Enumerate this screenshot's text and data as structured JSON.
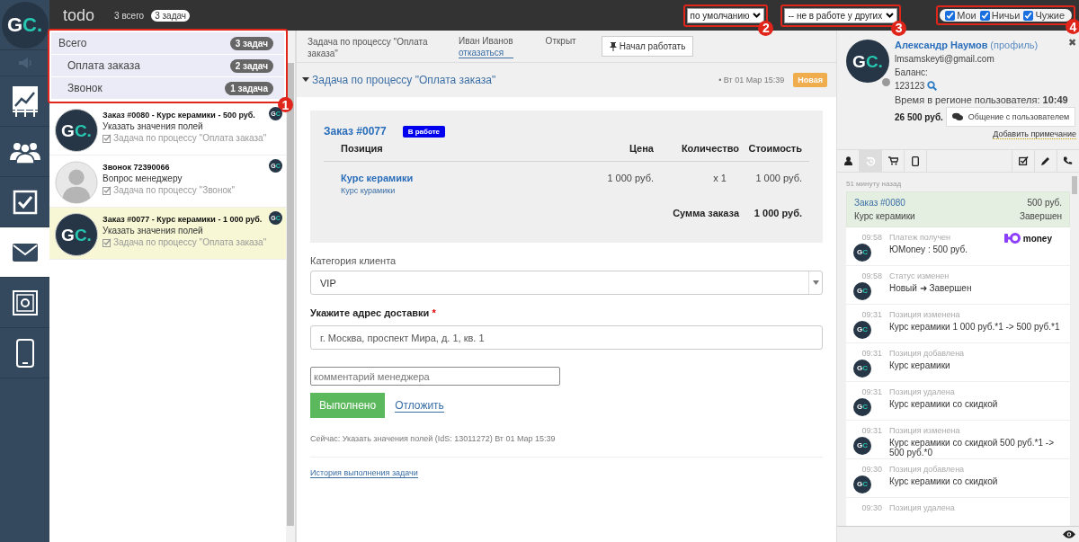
{
  "nav": {
    "logo": "GC.",
    "items": [
      {
        "kind": "speaker",
        "selected": false
      },
      {
        "kind": "chart",
        "selected": false
      },
      {
        "kind": "people",
        "selected": false
      },
      {
        "kind": "checkbox",
        "selected": false
      },
      {
        "kind": "mail",
        "selected": true
      },
      {
        "kind": "safe",
        "selected": false
      },
      {
        "kind": "phone",
        "selected": false
      }
    ]
  },
  "topbar": {
    "title": "todo",
    "total": "3 всего",
    "badge": "3 задач",
    "sort_select": {
      "value": "по умолчанию",
      "callout": "2"
    },
    "filter_select": {
      "value": "-- не в работе у других",
      "callout": "3"
    },
    "owner_filters": {
      "callout": "4",
      "options": [
        {
          "label": "Мои",
          "checked": true
        },
        {
          "label": "Ничьи",
          "checked": true
        },
        {
          "label": "Чужие",
          "checked": true
        }
      ]
    }
  },
  "task_groups": {
    "callout": "1",
    "items": [
      {
        "label": "Всего",
        "count": "3 задач",
        "children": [
          {
            "label": "Оплата заказа",
            "count": "2 задач"
          },
          {
            "label": "Звонок",
            "count": "1 задача"
          }
        ]
      }
    ]
  },
  "tasks": [
    {
      "title": "Заказ #0080 - Курс керамики - 500 руб.",
      "subtitle": "Указать значения полей",
      "process": "Задача по процессу \"Оплата заказа\"",
      "avatar": {
        "kind": "logo",
        "text": "GC."
      },
      "badge": "GC",
      "selected": false
    },
    {
      "title": "Звонок 72390066",
      "subtitle": "Вопрос менеджеру",
      "process": "Задача по процессу \"Звонок\"",
      "avatar": {
        "kind": "person"
      },
      "badge": "GC",
      "selected": false
    },
    {
      "title": "Заказ #0077 - Курс керамики - 1 000 руб.",
      "subtitle": "Указать значения полей",
      "process": "Задача по процессу \"Оплата заказа\"",
      "avatar": {
        "kind": "logo",
        "text": "GC."
      },
      "badge": "GC",
      "selected": true
    }
  ],
  "task_header": {
    "process": "Задача по процессу \"Оплата заказа\"",
    "assignee": "Иван Иванов",
    "decline_link": "отказаться",
    "status": "Открыт",
    "start_button": "Начал работать"
  },
  "task_title": {
    "link": "Задача по процессу \"Оплата заказа\"",
    "expanded": true,
    "date": "• Вт 01 Мар 15:39",
    "badge": "Новая"
  },
  "order": {
    "title": "Заказ #0077",
    "status": "В работе",
    "columns": [
      "Позиция",
      "Цена",
      "Количество",
      "Стоимость"
    ],
    "rows": [
      {
        "name": "Курс керамики",
        "note": "Курс курамики",
        "price": "1 000 руб.",
        "quantity": "x 1",
        "cost": "1 000 руб."
      }
    ],
    "total_label": "Сумма заказа",
    "total": "1 000 руб."
  },
  "form": {
    "category_label": "Категория клиента",
    "category_value": "VIP",
    "address_label": "Укажите адрес доставки",
    "required_mark": "*",
    "address_value": "г. Москва, проспект Мира, д. 1, кв. 1",
    "comment_placeholder": "комментарий менеджера",
    "done_button": "Выполнено",
    "postpone_link": "Отложить",
    "status_line": "Сейчас: Указать значения полей (IdS: 13011272) Вт 01 Мар 15:39",
    "history_link": "История выполнения задачи"
  },
  "profile": {
    "avatar": "GC.",
    "online": false,
    "name": "Александр Наумов",
    "profile_link": "(профиль)",
    "email": "lmsamskeyti@gmail.com",
    "balance_label": "Баланс:",
    "balance": "123123",
    "region_time": "Время в регионе пользователя: **10:49**",
    "amount": "26 500 руб.",
    "chat_button": "Общение с пользователем",
    "note_link": "Добавить примечание",
    "close": "✖"
  },
  "panel_tabs": [
    {
      "kind": "person",
      "selected": false
    },
    {
      "kind": "history",
      "selected": true
    },
    {
      "kind": "cart",
      "selected": false
    },
    {
      "kind": "tablet",
      "selected": false
    },
    {
      "kind": "checkbox",
      "selected": false
    },
    {
      "kind": "pencil",
      "selected": false
    },
    {
      "kind": "phone",
      "selected": false
    }
  ],
  "feed": {
    "ago": "51 минуту назад",
    "order": {
      "title": "Заказ #0080",
      "amount": "500 руб.",
      "product": "Курс керамики",
      "status": "Завершен"
    },
    "events": [
      {
        "time": "09:58",
        "title": "Платеж получен",
        "text": "ЮMoney : 500 руб.",
        "avatar": "GC",
        "logo": "money"
      },
      {
        "time": "09:58",
        "title": "Статус изменен",
        "text": "Новый ➜ Завершен",
        "avatar": "GC"
      },
      {
        "time": "09:31",
        "title": "Позиция изменена",
        "text": "Курс керамики 1 000 руб.*1 -> 500 руб.*1",
        "avatar": "GC"
      },
      {
        "time": "09:31",
        "title": "Позиция добавлена",
        "text": "Курс керамики",
        "avatar": "GC"
      },
      {
        "time": "09:31",
        "title": "Позиция удалена",
        "text": "Курс керамики со скидкой",
        "avatar": "GC"
      },
      {
        "time": "09:31",
        "title": "Позиция изменена",
        "text": "Курс керамики со скидкой 500 руб.*1 -> 500 руб.*0",
        "avatar": "GC"
      },
      {
        "time": "09:30",
        "title": "Позиция добавлена",
        "text": "Курс керамики со скидкой",
        "avatar": "GC"
      },
      {
        "time": "09:30",
        "title": "Позиция удалена"
      }
    ]
  }
}
